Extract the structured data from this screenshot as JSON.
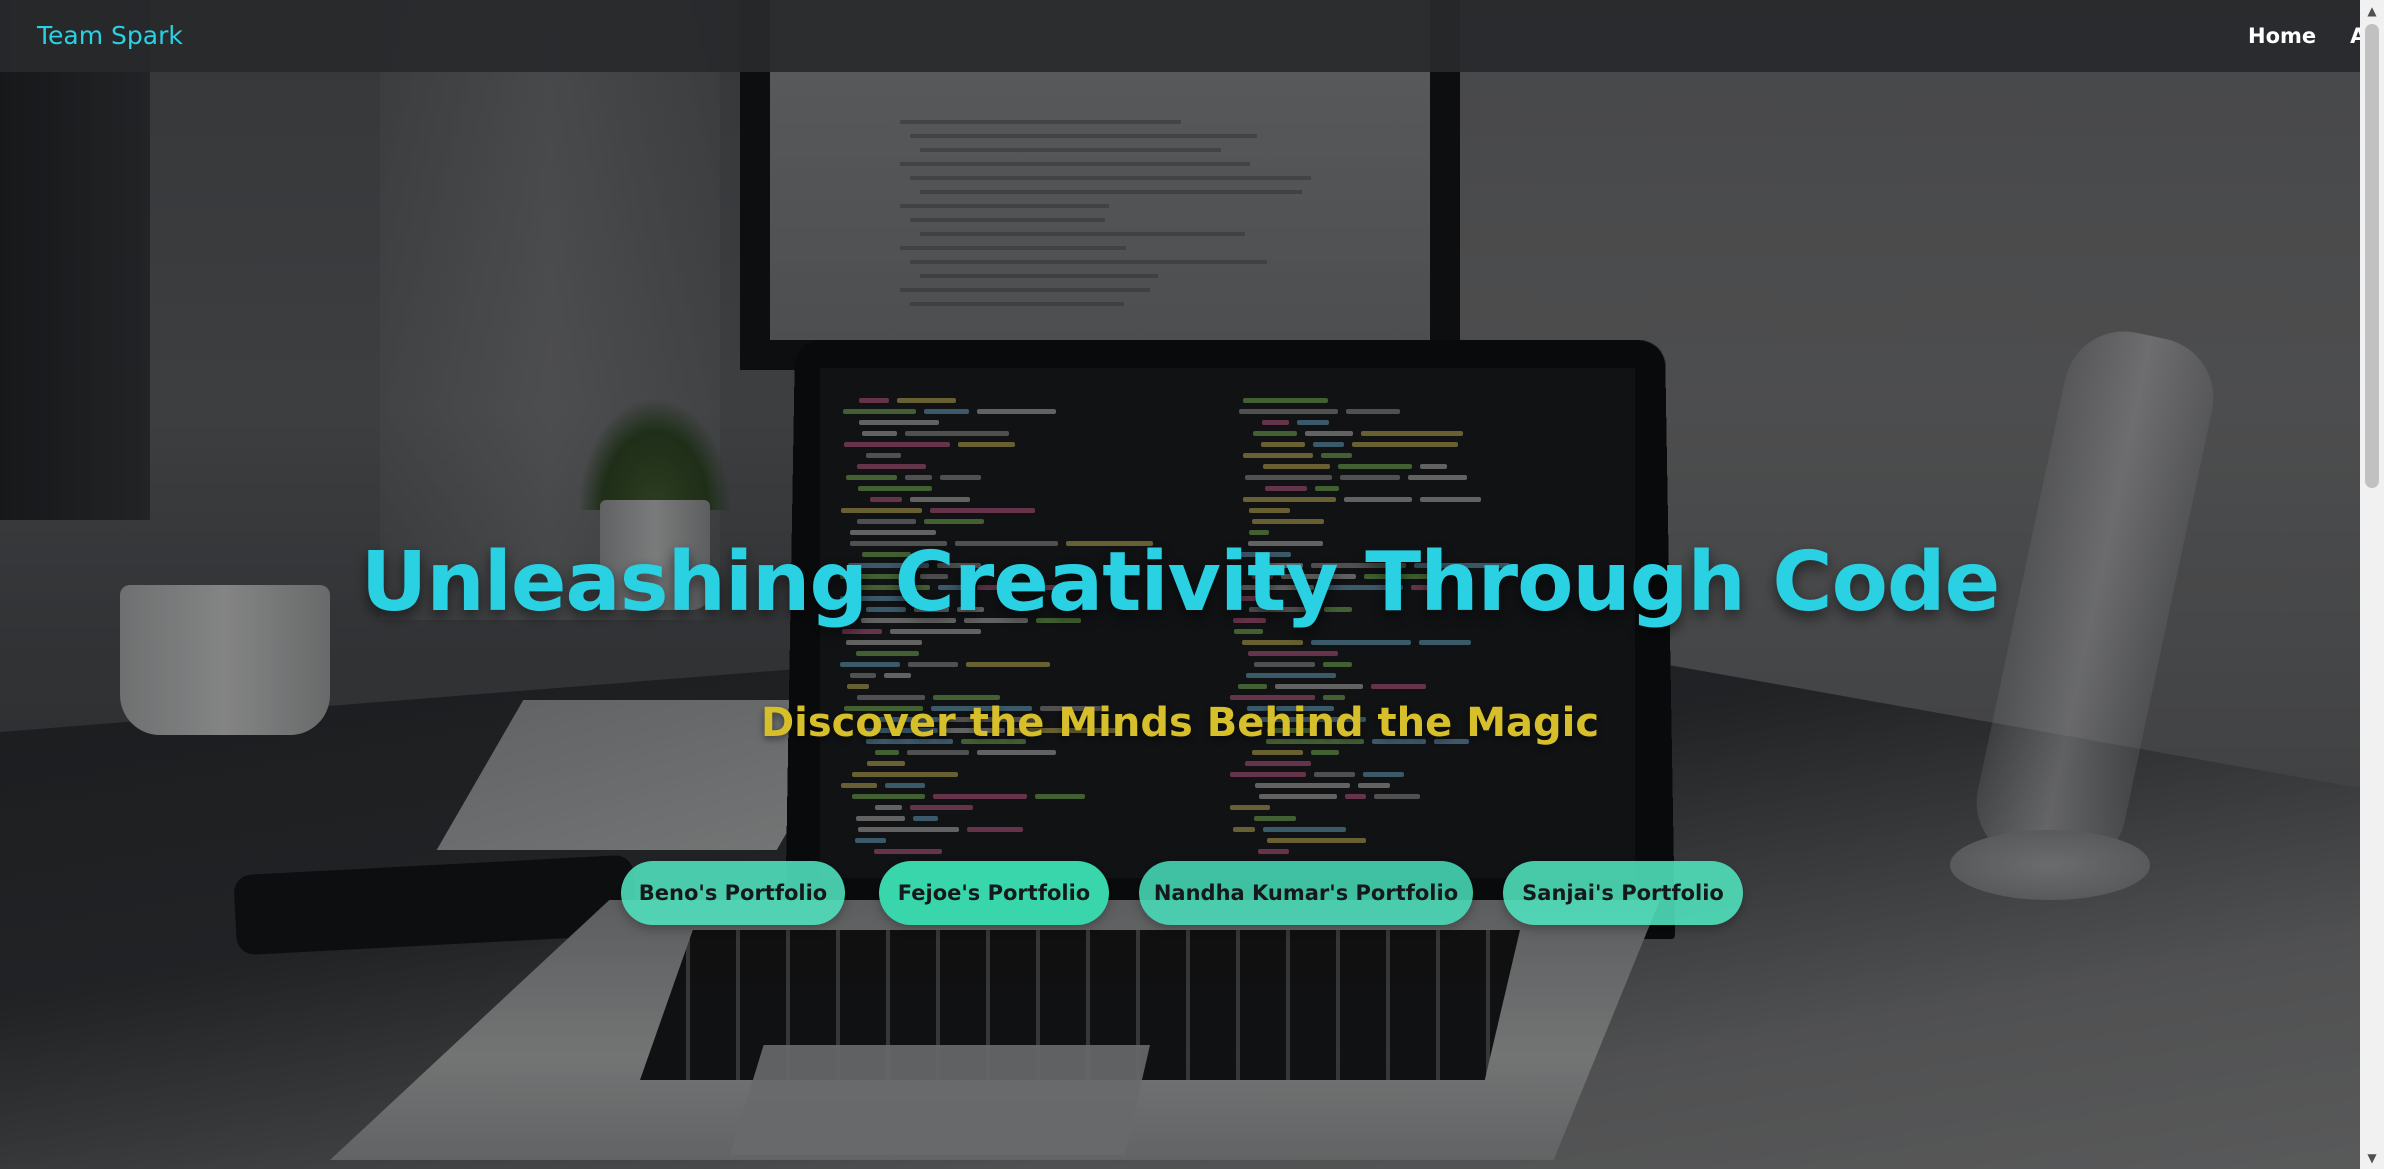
{
  "nav": {
    "brand": "Team Spark",
    "links": [
      "Home",
      "About"
    ]
  },
  "hero": {
    "title": "Unleashing Creativity Through Code",
    "subtitle": "Discover the Minds Behind the Magic"
  },
  "portfolios": [
    "Beno's Portfolio",
    "Fejoe's Portfolio",
    "Nandha Kumar's Portfolio",
    "Sanjai's Portfolio"
  ],
  "colors": {
    "brand": "#2ad1e3",
    "subtitle": "#d6bf2a",
    "button": "#3fe0b4",
    "navbar": "#28292b"
  },
  "icons": {
    "scroll_up": "triangle-up-icon",
    "scroll_down": "triangle-down-icon"
  }
}
